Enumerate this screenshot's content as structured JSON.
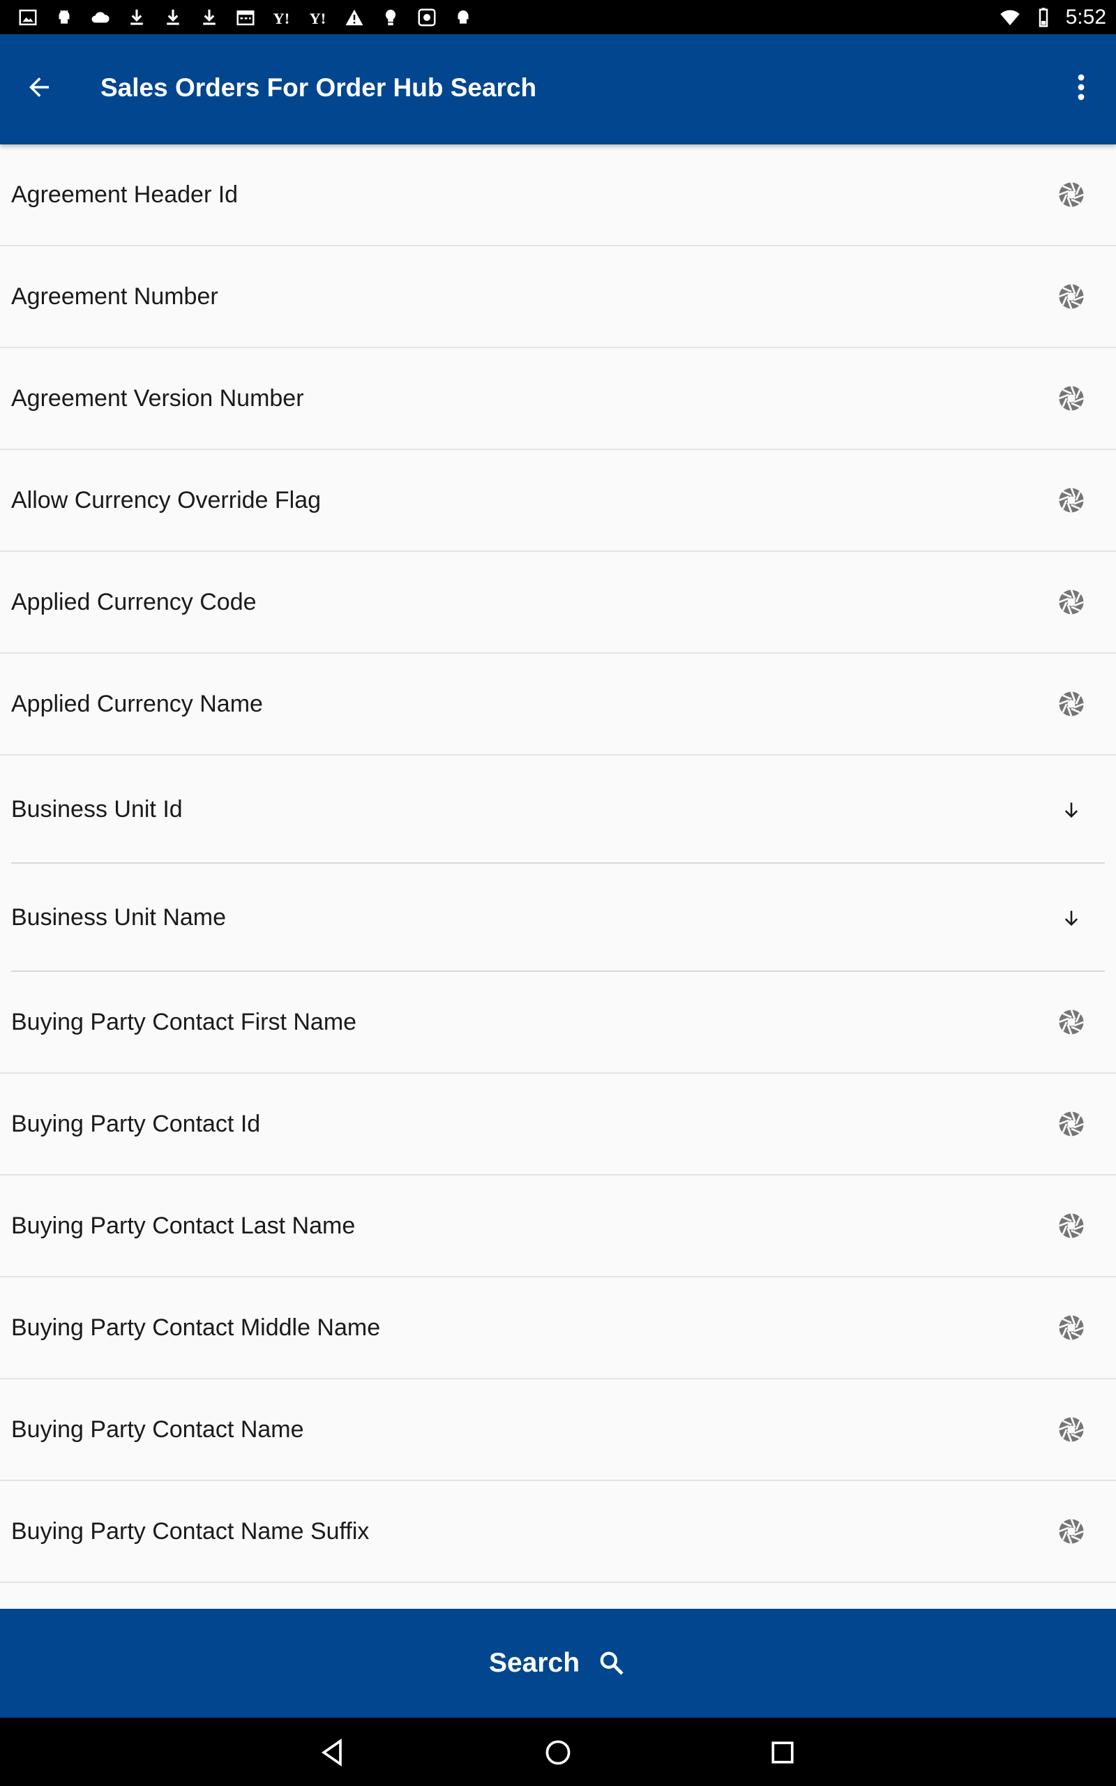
{
  "status_bar": {
    "time": "5:52",
    "left_icons": [
      "image-icon",
      "android-icon",
      "cloud-icon",
      "download-icon",
      "download-icon",
      "download-icon",
      "calendar-icon",
      "yahoo-icon",
      "yahoo-icon",
      "warning-icon",
      "bulb-icon",
      "photo-icon",
      "android-icon"
    ],
    "right_icons": [
      "wifi-icon",
      "battery-icon"
    ]
  },
  "app_bar": {
    "title": "Sales Orders For Order Hub Search",
    "back_icon": "arrow-back-icon",
    "menu_icon": "more-vert-icon"
  },
  "fields": [
    {
      "label": "Agreement Header Id",
      "icon": "aperture-icon",
      "kind": "field"
    },
    {
      "label": "Agreement Number",
      "icon": "aperture-icon",
      "kind": "field"
    },
    {
      "label": "Agreement Version Number",
      "icon": "aperture-icon",
      "kind": "field"
    },
    {
      "label": "Allow Currency Override Flag",
      "icon": "aperture-icon",
      "kind": "field"
    },
    {
      "label": "Applied Currency Code",
      "icon": "aperture-icon",
      "kind": "field"
    },
    {
      "label": "Applied Currency Name",
      "icon": "aperture-icon",
      "kind": "field"
    },
    {
      "label": "Business Unit Id",
      "icon": "arrow-down-icon",
      "kind": "dropdown"
    },
    {
      "label": "Business Unit Name",
      "icon": "arrow-down-icon",
      "kind": "dropdown"
    },
    {
      "label": "Buying Party Contact First Name",
      "icon": "aperture-icon",
      "kind": "field"
    },
    {
      "label": "Buying Party Contact Id",
      "icon": "aperture-icon",
      "kind": "field"
    },
    {
      "label": "Buying Party Contact Last Name",
      "icon": "aperture-icon",
      "kind": "field"
    },
    {
      "label": "Buying Party Contact Middle Name",
      "icon": "aperture-icon",
      "kind": "field"
    },
    {
      "label": "Buying Party Contact Name",
      "icon": "aperture-icon",
      "kind": "field"
    },
    {
      "label": "Buying Party Contact Name Suffix",
      "icon": "aperture-icon",
      "kind": "field"
    }
  ],
  "search_button": {
    "label": "Search",
    "icon": "search-icon"
  },
  "nav_bar": {
    "buttons": [
      "back-triangle-icon",
      "home-circle-icon",
      "recents-square-icon"
    ]
  },
  "colors": {
    "primary": "#02468f",
    "background": "#fafafa",
    "divider": "#e4e4e4",
    "icon_gray": "#757575",
    "text": "#1a1a1a"
  }
}
